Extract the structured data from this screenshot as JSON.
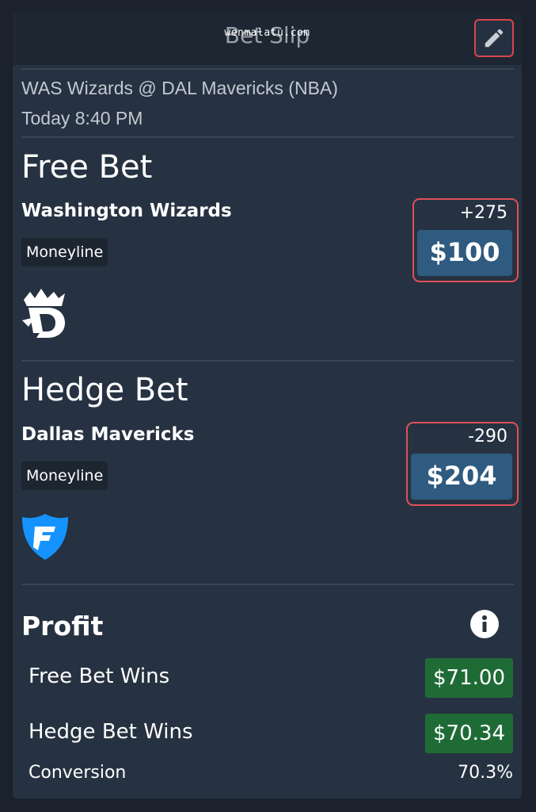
{
  "header": {
    "title": "Bet Slip",
    "watermark": "wenmalatu.com",
    "edit_icon": "pencil-icon"
  },
  "event": {
    "matchup": "WAS Wizards @ DAL Mavericks (NBA)",
    "time": "Today 8:40 PM"
  },
  "free_bet": {
    "title": "Free Bet",
    "team": "Washington Wizards",
    "market": "Moneyline",
    "odds": "+275",
    "stake": "$100",
    "sportsbook_icon": "draftkings-logo-icon"
  },
  "hedge_bet": {
    "title": "Hedge Bet",
    "team": "Dallas Mavericks",
    "market": "Moneyline",
    "odds": "-290",
    "stake": "$204",
    "sportsbook_icon": "fanduel-logo-icon"
  },
  "profit": {
    "title": "Profit",
    "info_icon": "info-icon",
    "rows": [
      {
        "label": "Free Bet Wins",
        "value": "$71.00"
      },
      {
        "label": "Hedge Bet Wins",
        "value": "$70.34"
      }
    ],
    "conversion_label": "Conversion",
    "conversion_value": "70.3%"
  },
  "colors": {
    "background": "#1b222d",
    "card": "#263241",
    "highlight_border": "#e0505b",
    "stake_bg": "#2f5b80",
    "profit_bg": "#1f6b36",
    "fanduel_blue": "#1493ff"
  }
}
